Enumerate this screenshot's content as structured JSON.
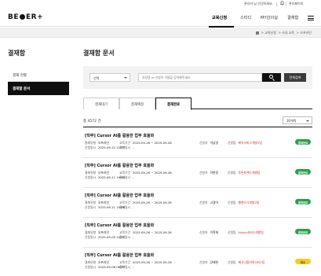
{
  "topbar": {
    "user_greeting": "관리자 님 안녕하세요.",
    "bell_icon": "bell-icon",
    "mypage_label": "관리페이지"
  },
  "header": {
    "logo_left": "BE",
    "logo_right": "ER+",
    "nav": [
      "교육신청",
      "스터디",
      "MY강의실",
      "결제함"
    ],
    "active_nav_index": 0,
    "menu_icon": "hamburger-icon"
  },
  "breadcrumb": {
    "home_icon": "home-icon",
    "items": [
      "교육신청",
      "사내 교육",
      "오프라인"
    ]
  },
  "sidebar": {
    "title": "결재함",
    "items": [
      {
        "label": "결재 현황"
      },
      {
        "label": "결재할 문서"
      }
    ],
    "active_index": 1
  },
  "main": {
    "title": "결재함 문서",
    "search": {
      "select_value": "선택",
      "placeholder": "과정명 or 신청자 이름을 입력해주세요.",
      "search_icon": "search-icon",
      "all_button": "전체검색"
    },
    "tabs": [
      "결재대기",
      "결재예정",
      "결재완료"
    ],
    "active_tab_index": 2,
    "count_label": "총 4572 건",
    "page_size": "30개씩",
    "labels": {
      "type": "결재유형",
      "date": "신청일시",
      "period": "교육기간",
      "approve_date": "결재일시",
      "applicant": "신청자",
      "dept": "신청팀"
    },
    "rows": [
      {
        "title": "[직무] Cursor AI를 활용한 업무 효율화",
        "type": "오프라인",
        "date": "2025-09-12 11:07",
        "period": "2025-09-26 ~ 2025-09-26",
        "approve_date": "-",
        "applicant": "이남영",
        "dept": "제유서비스개발1팀",
        "status": "결재완료",
        "status_color": "#2e9e4b"
      },
      {
        "title": "[직무] Cursor AI를 활용한 업무 효율화",
        "type": "오프라인",
        "date": "2025-09-11 19:44",
        "period": "2025-09-26 ~ 2025-09-26",
        "approve_date": "-",
        "applicant": "곽현정",
        "dept": "투톤프랜드개발팀",
        "status": "결재완료",
        "status_color": "#2e9e4b"
      },
      {
        "title": "[직무] Cursor AI를 활용한 업무 효율화",
        "type": "오프라인",
        "date": "2025-09-11 15:16",
        "period": "2025-09-26 ~ 2025-09-26",
        "approve_date": "-",
        "applicant": "고경아",
        "dept": "웹젠스디개발2팀",
        "status": "결재완료",
        "status_color": "#2e9e4b"
      },
      {
        "title": "[직무] Cursor AI를 활용한 업무 효율화",
        "type": "오프라인",
        "date": "2025-09-09 10:01",
        "period": "2025-09-26 ~ 2025-09-26",
        "approve_date": "-",
        "applicant": "이학재",
        "dept": "Vision서비스개발팀",
        "status": "결재완료",
        "status_color": "#2e9e4b"
      },
      {
        "title": "[직무] Cursor AI를 활용한 업무 효율화",
        "type": "오프라인",
        "date": "2025-09-08 06:37",
        "period": "2025-09-26 ~ 2025-09-26",
        "approve_date": "-",
        "applicant": "강태현",
        "dept": "메고나합커뮤니티2팀",
        "status": "취소",
        "status_color": "#f2cd1f"
      }
    ]
  }
}
